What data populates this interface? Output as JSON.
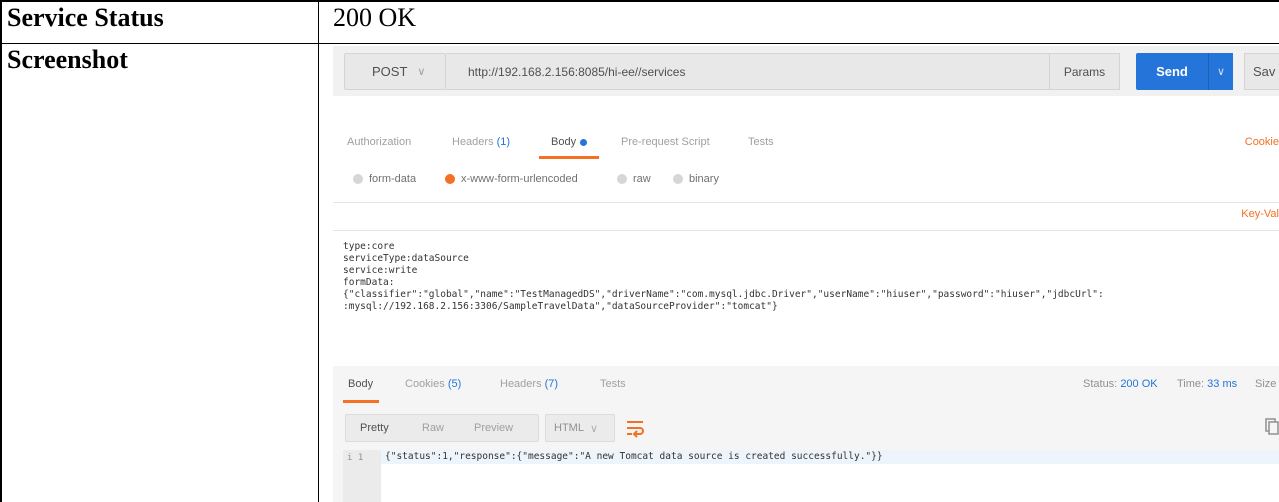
{
  "table": {
    "rows": [
      {
        "label": "Service Status",
        "value": "200 OK"
      },
      {
        "label": "Screenshot",
        "value": ""
      }
    ]
  },
  "request": {
    "method": "POST",
    "url": "http://192.168.2.156:8085/hi-ee//services",
    "params_label": "Params",
    "send_label": "Send",
    "save_label": "Sav"
  },
  "request_tabs": {
    "authorization": "Authorization",
    "headers": "Headers",
    "headers_count": "(1)",
    "body": "Body",
    "prerequest": "Pre-request Script",
    "tests": "Tests",
    "cookies_link": "Cookie"
  },
  "body_modes": {
    "form_data": "form-data",
    "urlencoded": "x-www-form-urlencoded",
    "raw": "raw",
    "binary": "binary",
    "selected": "x-www-form-urlencoded"
  },
  "bulk_edit": {
    "toggle_label": "Key-Val",
    "text": "type:core\nserviceType:dataSource\nservice:write\nformData:\n{\"classifier\":\"global\",\"name\":\"TestManagedDS\",\"driverName\":\"com.mysql.jdbc.Driver\",\"userName\":\"hiuser\",\"password\":\"hiuser\",\"jdbcUrl\":\n:mysql://192.168.2.156:3306/SampleTravelData\",\"dataSourceProvider\":\"tomcat\"}"
  },
  "response": {
    "tabs": {
      "body": "Body",
      "cookies": "Cookies",
      "cookies_count": "(5)",
      "headers": "Headers",
      "headers_count": "(7)",
      "tests": "Tests"
    },
    "status_label": "Status:",
    "status_value": "200 OK",
    "time_label": "Time:",
    "time_value": "33 ms",
    "size_label": "Size",
    "formats": {
      "pretty": "Pretty",
      "raw": "Raw",
      "preview": "Preview"
    },
    "language": "HTML",
    "line_number": "1",
    "line_info": "i",
    "code": "{\"status\":1,\"response\":{\"message\":\"A new Tomcat data source is created successfully.\"}}"
  },
  "colors": {
    "accent_orange": "#f47023",
    "send_blue": "#2574d9",
    "link_blue": "#2574d9"
  }
}
